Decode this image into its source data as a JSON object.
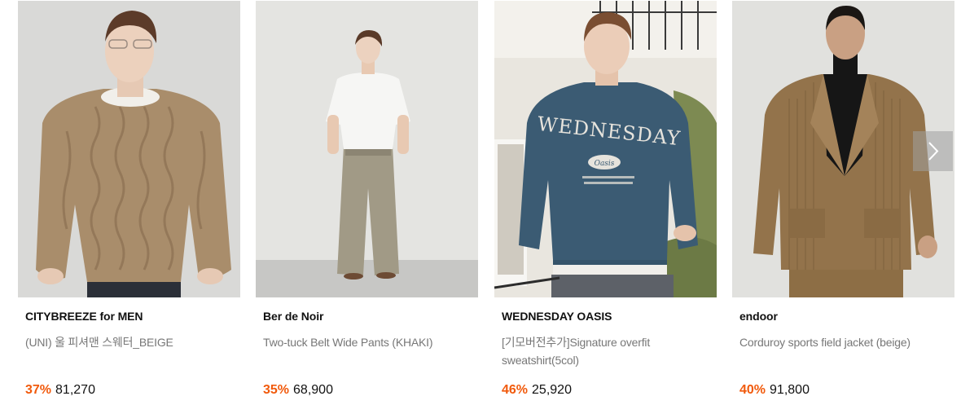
{
  "products": [
    {
      "brand": "CITYBREEZE for MEN",
      "name": "(UNI) 울 피셔맨 스웨터_BEIGE",
      "discount": "37%",
      "price": "81,270",
      "image": "man-in-beige-cable-knit-sweater"
    },
    {
      "brand": "Ber de Noir",
      "name": "Two-tuck Belt Wide Pants (KHAKI)",
      "discount": "35%",
      "price": "68,900",
      "image": "man-in-white-tee-and-khaki-wide-pants"
    },
    {
      "brand": "WEDNESDAY OASIS",
      "name": "[기모버전추가]Signature overfit sweatshirt(5col)",
      "discount": "46%",
      "price": "25,920",
      "image": "man-in-navy-wednesday-sweatshirt"
    },
    {
      "brand": "endoor",
      "name": "Corduroy sports field jacket (beige)",
      "discount": "40%",
      "price": "91,800",
      "image": "man-in-corduroy-field-jacket"
    }
  ],
  "print": {
    "sweatshirt_text": "WEDNESDAY",
    "sweatshirt_badge": "Oasis"
  },
  "colors": {
    "discount": "#f15a0c",
    "brand": "#111111",
    "product_name": "#777777"
  },
  "carousel": {
    "next_icon": "chevron-right-icon"
  }
}
